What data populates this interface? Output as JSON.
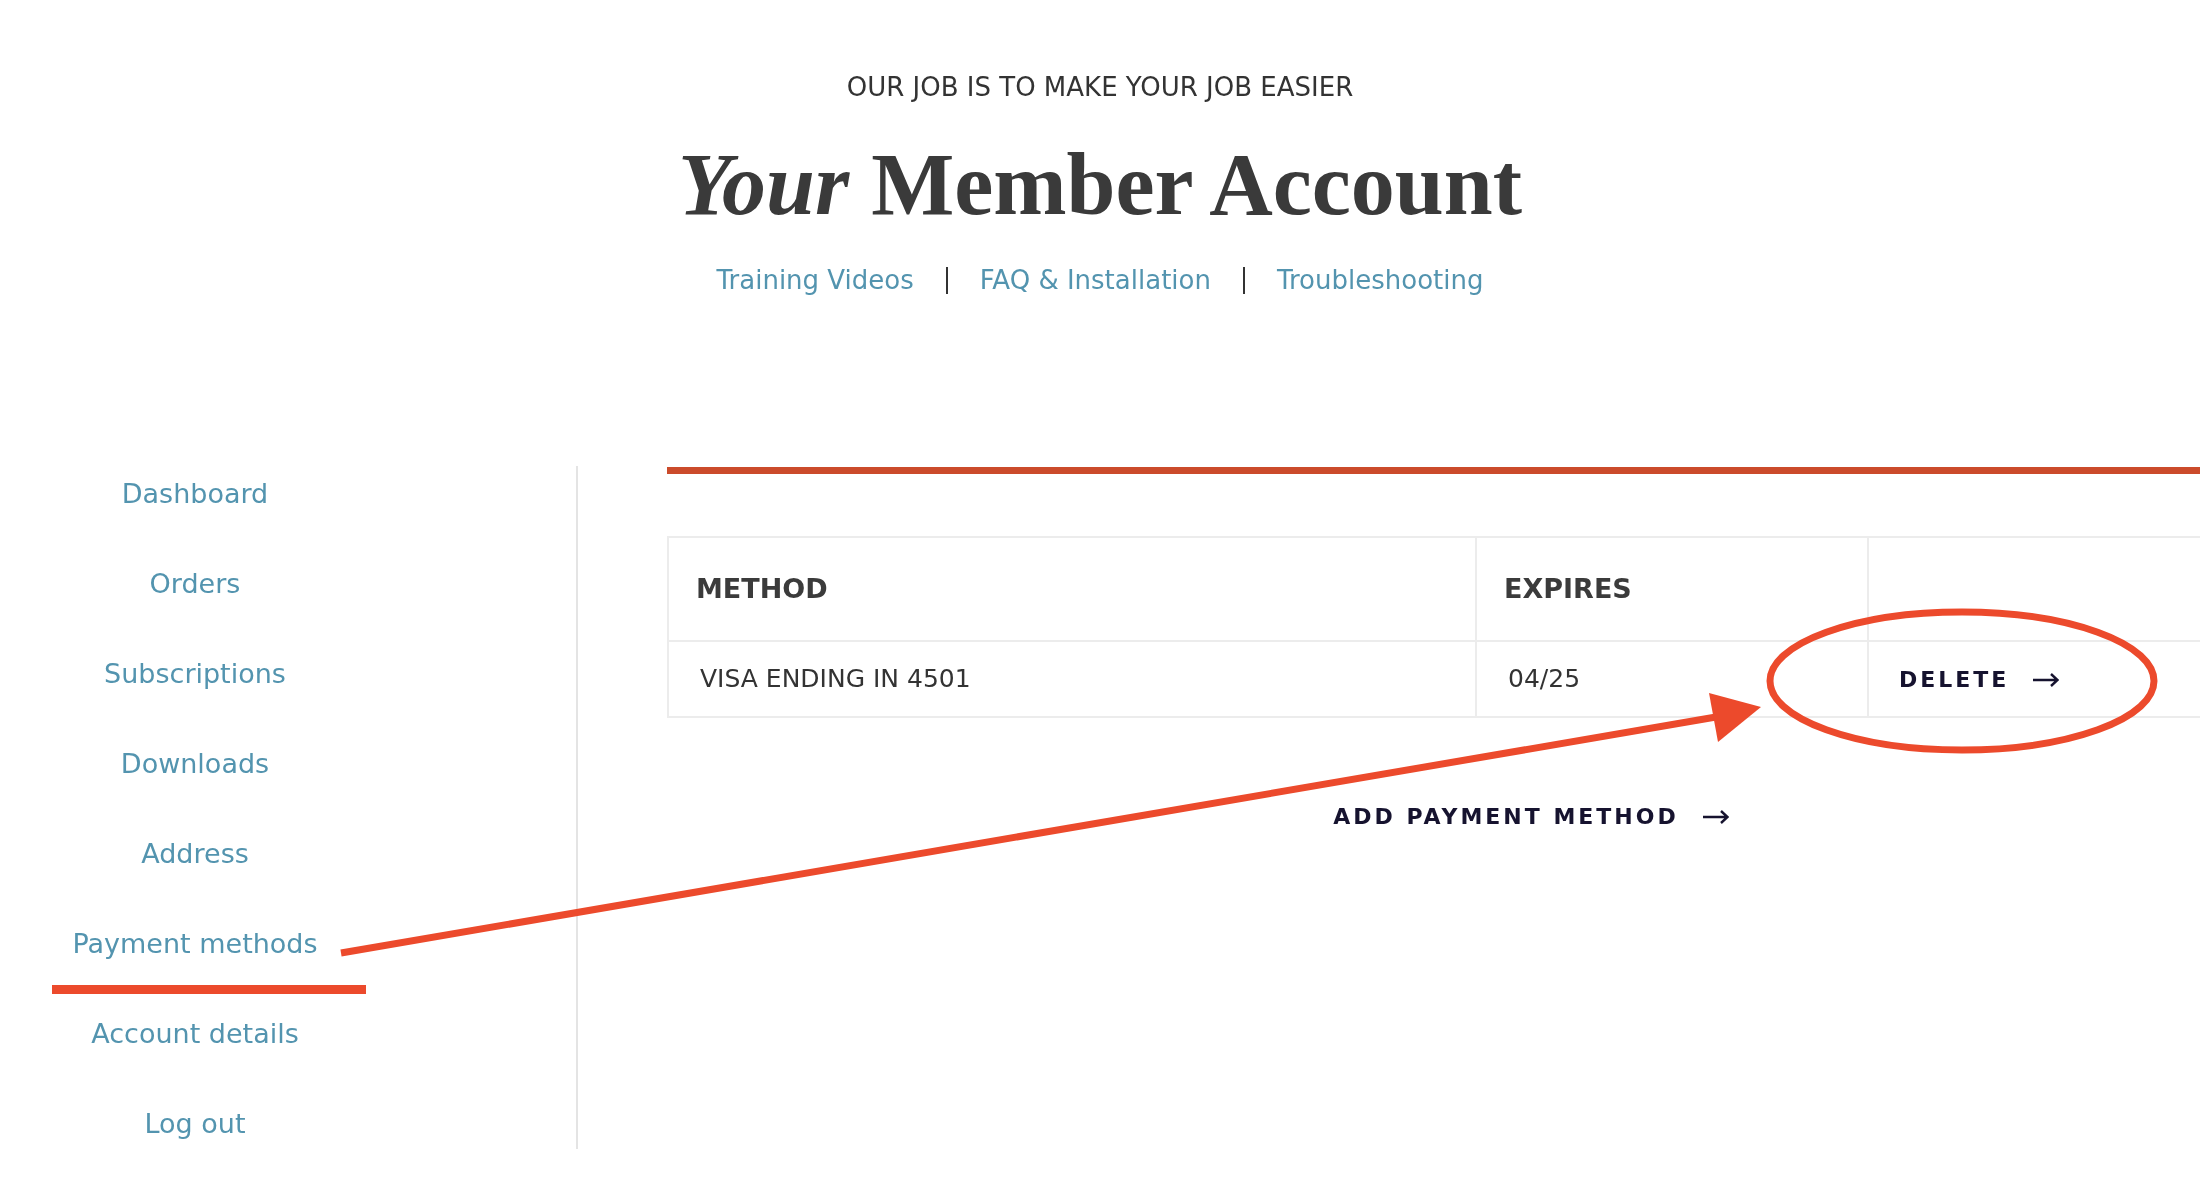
{
  "header": {
    "tagline": "OUR JOB IS TO MAKE YOUR JOB EASIER",
    "title": "*Your* Member Account",
    "links": [
      "Training Videos",
      "FAQ & Installation",
      "Troubleshooting"
    ]
  },
  "sidebar": {
    "items": [
      "Dashboard",
      "Orders",
      "Subscriptions",
      "Downloads",
      "Address",
      "Payment methods",
      "Account details",
      "Log out"
    ]
  },
  "payment_methods": {
    "table": {
      "columns": [
        "METHOD",
        "EXPIRES"
      ],
      "rows": [
        {
          "method": "VISA ENDING IN 4501",
          "expires": "04/25",
          "action": "DELETE"
        }
      ]
    },
    "add_button": "ADD PAYMENT METHOD"
  }
}
